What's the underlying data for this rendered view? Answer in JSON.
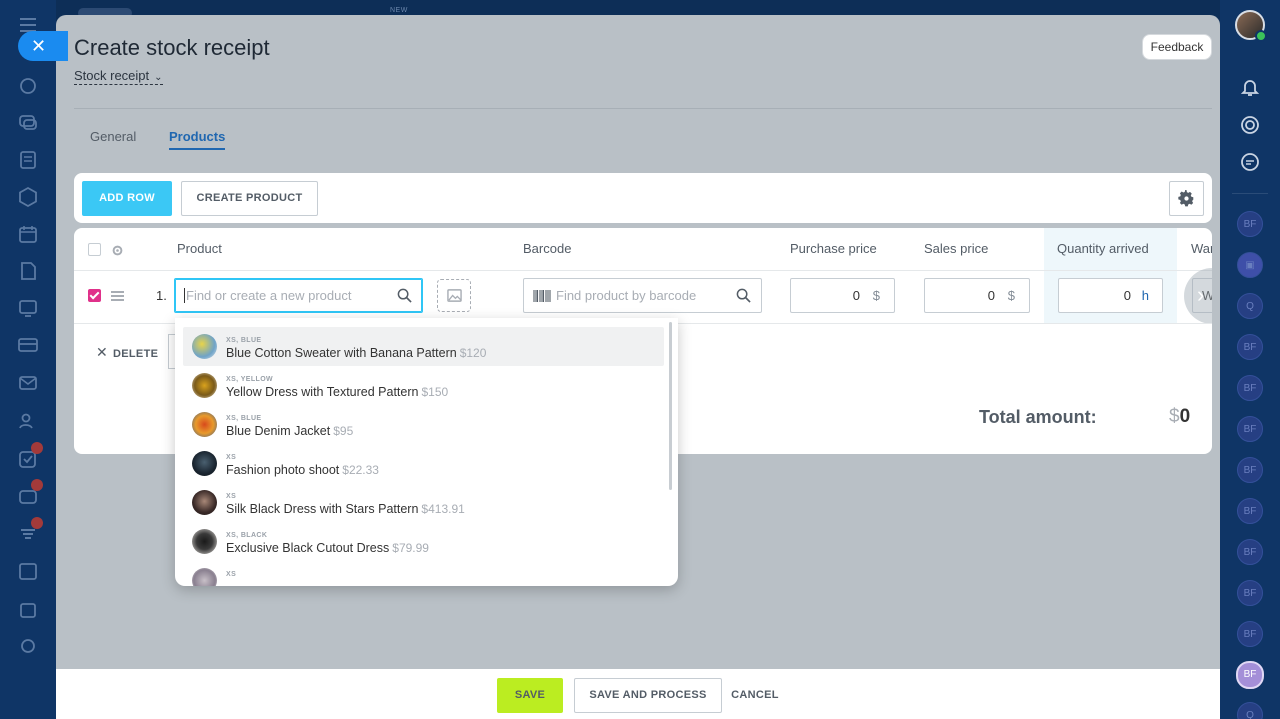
{
  "topnav": {
    "new_label": "NEW"
  },
  "header": {
    "title": "Create stock receipt",
    "subtitle": "Stock receipt",
    "feedback": "Feedback"
  },
  "tabs": {
    "general": "General",
    "products": "Products"
  },
  "toolbar": {
    "add_row": "ADD ROW",
    "create_product": "CREATE PRODUCT"
  },
  "grid": {
    "headers": {
      "product": "Product",
      "barcode": "Barcode",
      "purchase_price": "Purchase price",
      "sales_price": "Sales price",
      "quantity_arrived": "Quantity arrived",
      "warehouse": "War"
    },
    "row": {
      "number": "1.",
      "product_placeholder": "Find or create a new product",
      "barcode_placeholder": "Find product by barcode",
      "purchase_value": "0",
      "purchase_unit": "$",
      "sales_value": "0",
      "sales_unit": "$",
      "qty_value": "0",
      "qty_unit": "h",
      "warehouse_value": "W"
    },
    "delete_label": "DELETE",
    "total_label": "Total amount:",
    "total_currency": "$",
    "total_value": "0"
  },
  "dropdown": {
    "items": [
      {
        "attr": "XS, BLUE",
        "name": "Blue Cotton Sweater with Banana Pattern",
        "price": "$120"
      },
      {
        "attr": "XS, YELLOW",
        "name": "Yellow Dress with Textured Pattern",
        "price": "$150"
      },
      {
        "attr": "XS, BLUE",
        "name": "Blue Denim Jacket",
        "price": "$95"
      },
      {
        "attr": "XS",
        "name": "Fashion photo shoot",
        "price": "$22.33"
      },
      {
        "attr": "XS",
        "name": "Silk Black Dress with Stars Pattern",
        "price": "$413.91"
      },
      {
        "attr": "XS, BLACK",
        "name": "Exclusive Black Cutout Dress",
        "price": "$79.99"
      },
      {
        "attr": "XS",
        "name": "",
        "price": ""
      }
    ]
  },
  "footer": {
    "save": "SAVE",
    "save_process": "SAVE AND PROCESS",
    "cancel": "CANCEL"
  },
  "rightbar": {
    "bf_label": "BF",
    "q_label": "Q"
  },
  "colors": {
    "accent_blue": "#3bc8f5",
    "save_green": "#bbed21",
    "checkbox_pink": "#e0318a",
    "tab_active": "#2067b0"
  },
  "icons": {
    "close": "close-icon",
    "gear": "gear-icon",
    "search": "search-icon",
    "barcode": "barcode-icon",
    "image": "image-icon",
    "bell": "bell-icon",
    "drag": "drag-handle-icon"
  }
}
